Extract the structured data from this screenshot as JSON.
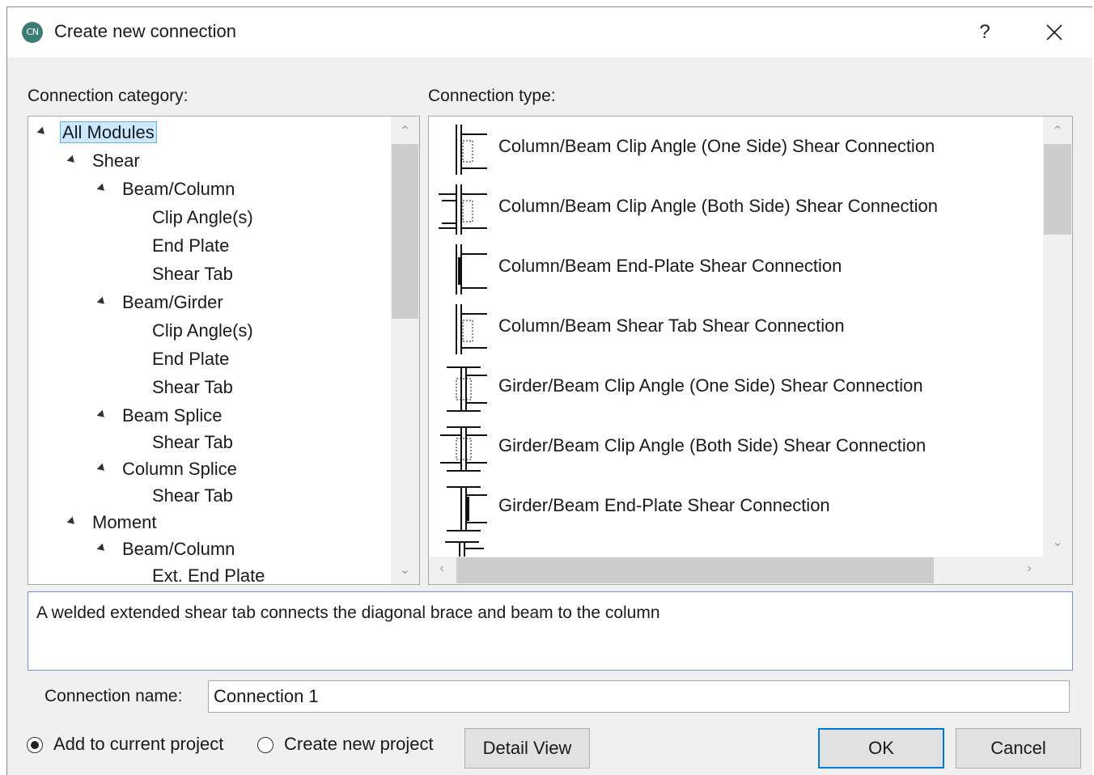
{
  "window": {
    "icon_text": "CN",
    "title": "Create new connection",
    "help_label": "?"
  },
  "labels": {
    "category": "Connection category:",
    "type": "Connection type:",
    "name": "Connection name:"
  },
  "tree": [
    {
      "label": "All Modules",
      "level": 0,
      "expanded": true,
      "selected": true
    },
    {
      "label": "Shear",
      "level": 1,
      "expanded": true
    },
    {
      "label": "Beam/Column",
      "level": 2,
      "expanded": true
    },
    {
      "label": "Clip Angle(s)",
      "level": 3
    },
    {
      "label": "End Plate",
      "level": 3
    },
    {
      "label": "Shear Tab",
      "level": 3
    },
    {
      "label": "Beam/Girder",
      "level": 2,
      "expanded": true
    },
    {
      "label": "Clip Angle(s)",
      "level": 3
    },
    {
      "label": "End Plate",
      "level": 3
    },
    {
      "label": "Shear Tab",
      "level": 3
    },
    {
      "label": "Beam Splice",
      "level": 2,
      "expanded": true
    },
    {
      "label": "Shear Tab",
      "level": 3
    },
    {
      "label": "Column Splice",
      "level": 2,
      "expanded": true
    },
    {
      "label": "Shear Tab",
      "level": 3
    },
    {
      "label": "Moment",
      "level": 1,
      "expanded": true
    },
    {
      "label": "Beam/Column",
      "level": 2,
      "expanded": true
    },
    {
      "label": "Ext. End Plate",
      "level": 3
    }
  ],
  "connection_types": [
    {
      "label": "Column/Beam Clip Angle (One Side) Shear Connection",
      "icon": "column-clip-angle-one-side-icon"
    },
    {
      "label": "Column/Beam Clip Angle (Both Side) Shear Connection",
      "icon": "column-clip-angle-both-side-icon"
    },
    {
      "label": "Column/Beam End-Plate Shear Connection",
      "icon": "column-end-plate-icon"
    },
    {
      "label": "Column/Beam Shear Tab Shear Connection",
      "icon": "column-shear-tab-icon"
    },
    {
      "label": "Girder/Beam Clip Angle (One Side) Shear Connection",
      "icon": "girder-clip-angle-one-side-icon"
    },
    {
      "label": "Girder/Beam Clip Angle (Both Side) Shear Connection",
      "icon": "girder-clip-angle-both-side-icon"
    },
    {
      "label": "Girder/Beam End-Plate Shear Connection",
      "icon": "girder-end-plate-icon"
    }
  ],
  "description": "A welded extended shear tab connects the diagonal brace and beam to the column",
  "connection_name": "Connection 1",
  "options": {
    "add_current": "Add to current project",
    "create_new": "Create new project",
    "selected": "add_current"
  },
  "buttons": {
    "detail": "Detail View",
    "ok": "OK",
    "cancel": "Cancel"
  },
  "colors": {
    "accent": "#0078d7",
    "selection": "#cce8ff",
    "icon_bg": "#3b7c75"
  }
}
